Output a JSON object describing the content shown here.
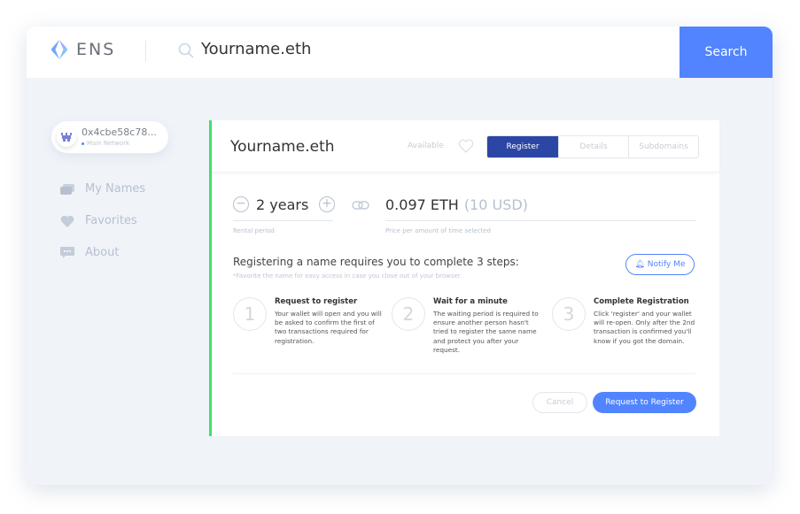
{
  "header": {
    "logo_text": "ENS",
    "search_value": "Yourname.eth",
    "search_button": "Search"
  },
  "account": {
    "address": "0x4cbe58c78...",
    "network": "Main Network"
  },
  "sidebar": {
    "items": [
      {
        "label": "My Names",
        "icon": "cards-icon"
      },
      {
        "label": "Favorites",
        "icon": "heart-icon"
      },
      {
        "label": "About",
        "icon": "chat-icon"
      }
    ]
  },
  "panel": {
    "name": "Yourname.eth",
    "status": "Available",
    "tabs": [
      {
        "label": "Register",
        "active": true
      },
      {
        "label": "Details"
      },
      {
        "label": "Subdomains"
      }
    ],
    "rental": {
      "value": "2 years",
      "label": "Rental period"
    },
    "price": {
      "eth": "0.097 ETH",
      "usd": "(10 USD)",
      "label": "Price per amount of time selected"
    },
    "steps_title": "Registering a name requires you to complete 3 steps:",
    "steps_note": "*Favorite the name for easy access in case you close out of your browser.",
    "notify_button": "Notify Me",
    "steps": [
      {
        "number": "1",
        "title": "Request to register",
        "desc": "Your wallet will open and you will be asked to confirm the first of two transactions required for registration."
      },
      {
        "number": "2",
        "title": "Wait for a minute",
        "desc": "The waiting period is required to ensure another person hasn't tried to register the same name and protect you after your request."
      },
      {
        "number": "3",
        "title": "Complete Registration",
        "desc": "Click 'register' and your wallet will re-open. Only after the 2nd transaction is confirmed you'll know if you got the domain."
      }
    ],
    "cancel_button": "Cancel",
    "request_button": "Request to Register"
  },
  "colors": {
    "accent": "#5284FF",
    "tab_active": "#2C46A6",
    "status_bar": "#42E068",
    "background": "#F0F4F9"
  }
}
